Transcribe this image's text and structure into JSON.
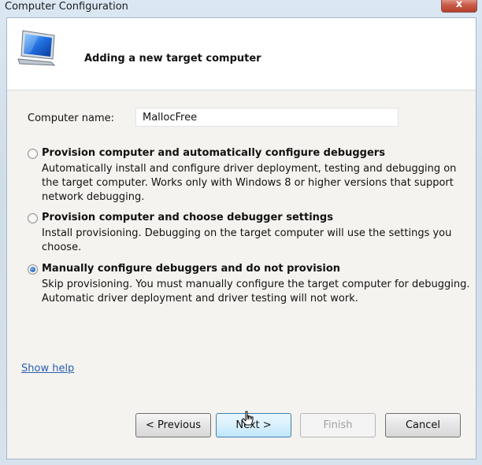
{
  "window": {
    "title": "Computer Configuration",
    "close_glyph": "x"
  },
  "header": {
    "heading": "Adding a new target computer",
    "icon": "monitor-icon"
  },
  "computer_name": {
    "label": "Computer name:",
    "value": "MallocFree"
  },
  "options": [
    {
      "title": "Provision computer and automatically configure debuggers",
      "description": "Automatically install and configure driver deployment, testing and debugging on the target computer. Works only with Windows 8 or higher versions that support network debugging.",
      "selected": false
    },
    {
      "title": "Provision computer and choose debugger settings",
      "description": "Install provisioning. Debugging on the target computer will use the settings you choose.",
      "selected": false
    },
    {
      "title": "Manually configure debuggers and do not provision",
      "description": "Skip provisioning. You must manually configure the target computer for debugging. Automatic driver deployment and driver testing will not work.",
      "selected": true
    }
  ],
  "help_link": "Show help",
  "buttons": {
    "previous": "< Previous",
    "next": "Next >",
    "finish": "Finish",
    "cancel": "Cancel"
  },
  "colors": {
    "link": "#2a5fb0",
    "radio_selected": "#2a6bc2",
    "close_button": "#c85b48"
  }
}
